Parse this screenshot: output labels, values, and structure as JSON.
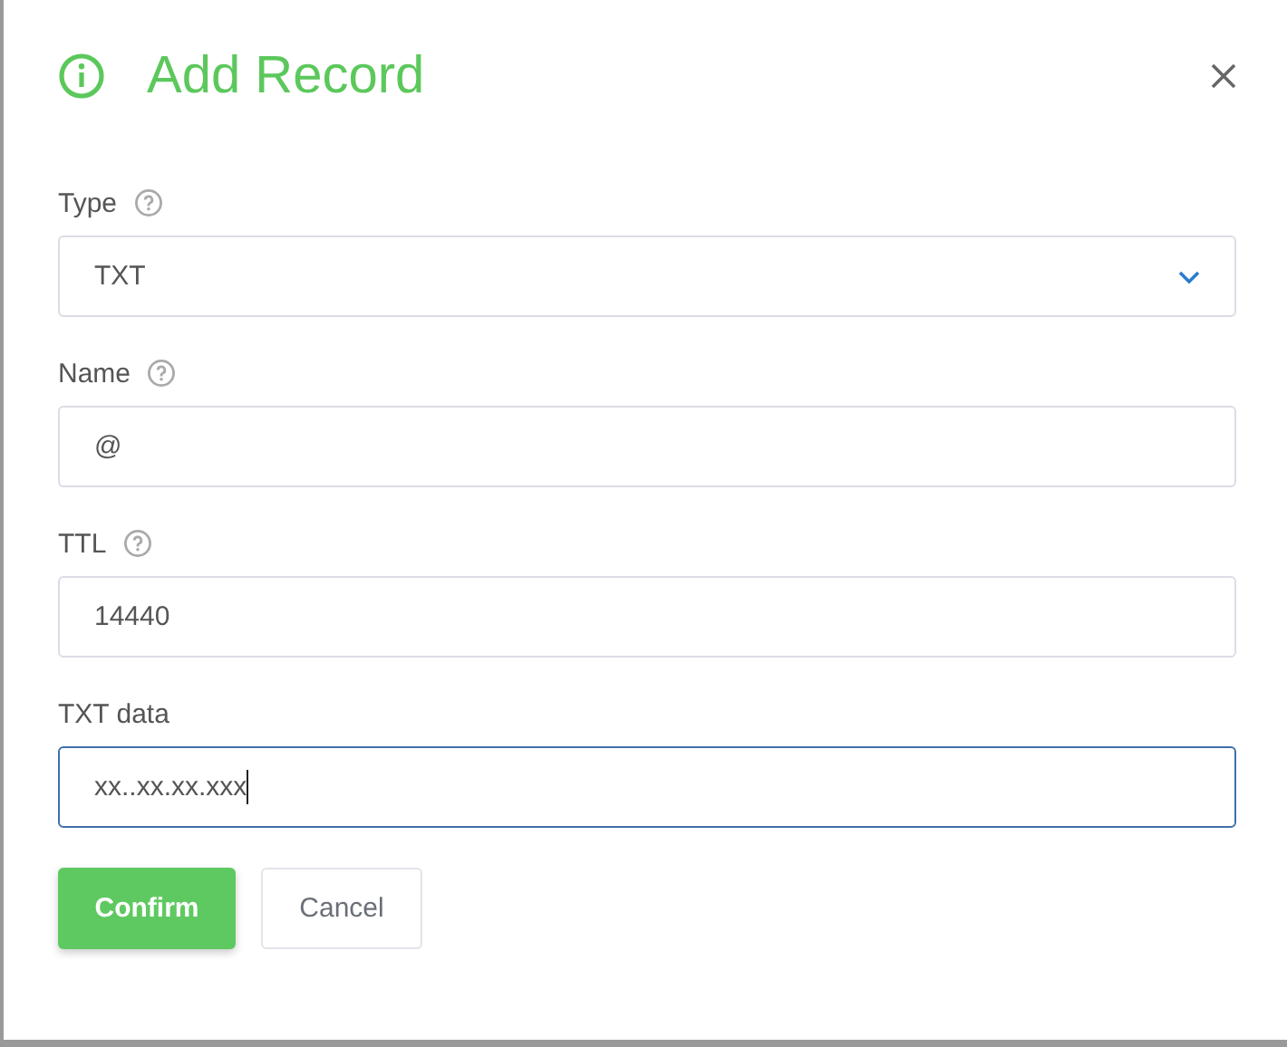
{
  "dialog": {
    "title": "Add Record"
  },
  "fields": [
    {
      "kind": "select",
      "label": "Type",
      "help": true,
      "value": "TXT",
      "focused": false
    },
    {
      "kind": "input",
      "label": "Name",
      "help": true,
      "value": "@",
      "focused": false
    },
    {
      "kind": "input",
      "label": "TTL",
      "help": true,
      "value": "14440",
      "focused": false
    },
    {
      "kind": "input",
      "label": "TXT data",
      "help": false,
      "value": "xx..xx.xx.xxx",
      "focused": true
    }
  ],
  "buttons": [
    {
      "kind": "primary",
      "label": "Confirm"
    },
    {
      "kind": "secondary",
      "label": "Cancel"
    }
  ]
}
